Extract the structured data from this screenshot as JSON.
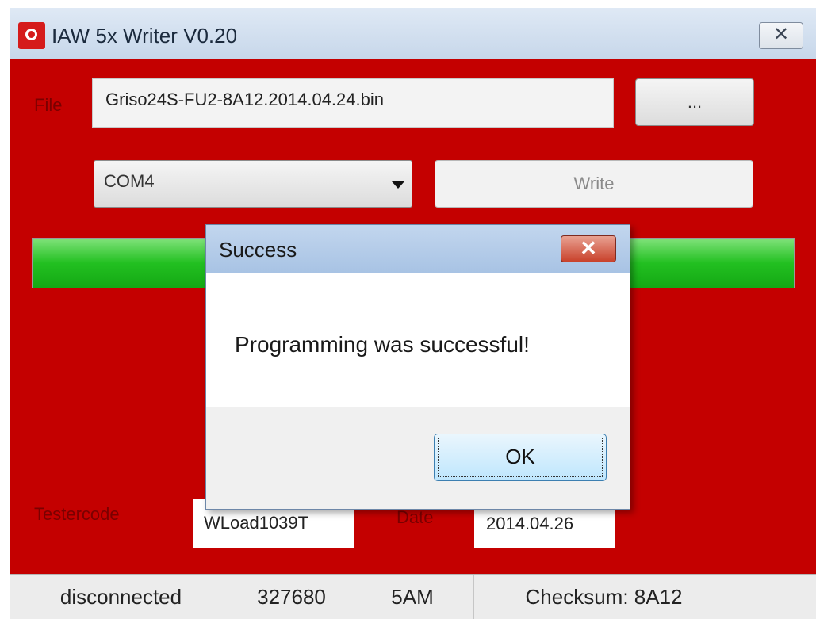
{
  "window": {
    "title": "IAW 5x Writer V0.20",
    "close_glyph": "✕",
    "icon": "app-logo-icon"
  },
  "file": {
    "label": "File",
    "value": "Griso24S-FU2-8A12.2014.04.24.bin",
    "browse_label": "..."
  },
  "port": {
    "selected": "COM4",
    "dropdown_icon": "chevron-down-icon"
  },
  "write_button": {
    "label": "Write",
    "enabled": false
  },
  "progress": {
    "value": 1.0
  },
  "tester": {
    "label": "Testercode",
    "value": "WLoad1039T"
  },
  "date": {
    "label": "Date",
    "value": "2014.04.26"
  },
  "statusbar": {
    "connection": "disconnected",
    "size": "327680",
    "type": "5AM",
    "checksum": "Checksum: 8A12"
  },
  "dialog": {
    "title": "Success",
    "close_glyph": "✕",
    "message": "Programming was successful!",
    "ok_label": "OK"
  },
  "colors": {
    "background": "#c40000",
    "progress": "#22c021"
  }
}
